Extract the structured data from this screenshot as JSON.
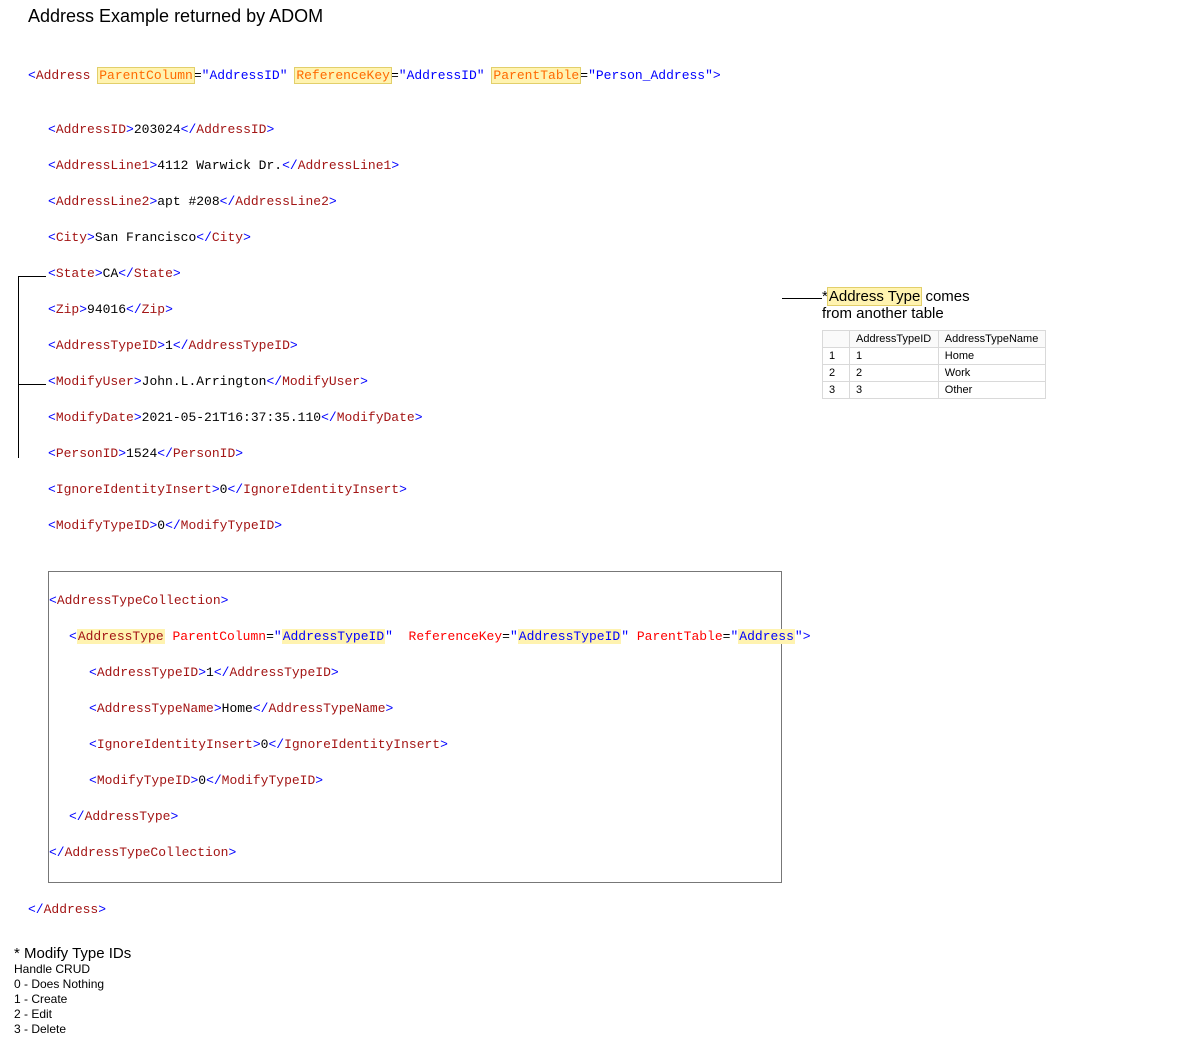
{
  "heading": "Address Example returned by ADOM",
  "root": {
    "tag": "Address",
    "parentColumn": "AddressID",
    "referenceKey": "AddressID",
    "parentTable": "Person_Address"
  },
  "fields": {
    "AddressID": "203024",
    "AddressLine1": "4112 Warwick Dr.",
    "AddressLine2": "apt #208",
    "City": "San Francisco",
    "State": "CA",
    "Zip": "94016",
    "AddressTypeID": "1",
    "ModifyUser": "John.L.Arrington",
    "ModifyDate": "2021-05-21T16:37:35.110",
    "PersonID": "1524",
    "IgnoreIdentityInsert": "0",
    "ModifyTypeID": "0"
  },
  "collectionTag": "AddressTypeCollection",
  "inner": {
    "tag": "AddressType",
    "parentColumn": "AddressTypeID",
    "referenceKey": "AddressTypeID",
    "parentTable": "Address",
    "AddressTypeID": "1",
    "AddressTypeName": "Home",
    "IgnoreIdentityInsert": "0",
    "ModifyTypeID": "0"
  },
  "attrNames": {
    "ParentColumn": "ParentColumn",
    "ReferenceKey": "ReferenceKey",
    "ParentTable": "ParentTable"
  },
  "side": {
    "prefix": "*",
    "highlight": "Address Type",
    "rest1": " comes",
    "rest2": "from another table",
    "headers": {
      "c1": "AddressTypeID",
      "c2": "AddressTypeName"
    },
    "rows": [
      {
        "n": "1",
        "id": "1",
        "name": "Home"
      },
      {
        "n": "2",
        "id": "2",
        "name": "Work"
      },
      {
        "n": "3",
        "id": "3",
        "name": "Other"
      }
    ]
  },
  "footer": {
    "title": "* Modify Type IDs",
    "sub": "Handle CRUD",
    "items": [
      "0 - Does Nothing",
      "1 - Create",
      "2 - Edit",
      "3 - Delete"
    ]
  }
}
